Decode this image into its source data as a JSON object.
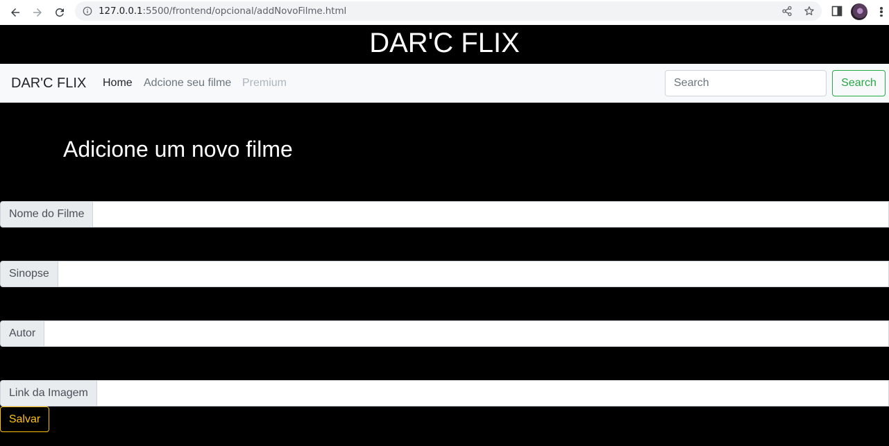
{
  "browser": {
    "url_host": "127.0.0.1",
    "url_rest": ":5500/frontend/opcional/addNovoFilme.html"
  },
  "site": {
    "title": "DAR'C FLIX"
  },
  "navbar": {
    "brand": "DAR'C FLIX",
    "links": [
      {
        "label": "Home",
        "state": "active",
        "color": "#212529"
      },
      {
        "label": "Adcione seu filme",
        "state": "normal",
        "color": "#6c757d"
      },
      {
        "label": "Premium",
        "state": "disabled",
        "color": "#adb5bd"
      }
    ],
    "search_placeholder": "Search",
    "search_button": "Search"
  },
  "main": {
    "heading": "Adicione um novo filme",
    "fields": [
      {
        "label": "Nome do Filme",
        "value": ""
      },
      {
        "label": "Sinopse",
        "value": ""
      },
      {
        "label": "Autor",
        "value": ""
      },
      {
        "label": "Link da Imagem",
        "value": ""
      }
    ],
    "save_button": "Salvar"
  },
  "colors": {
    "success": "#28a745",
    "warning": "#ffc107",
    "page_background": "#000000",
    "navbar_background": "#f8f9fa"
  }
}
